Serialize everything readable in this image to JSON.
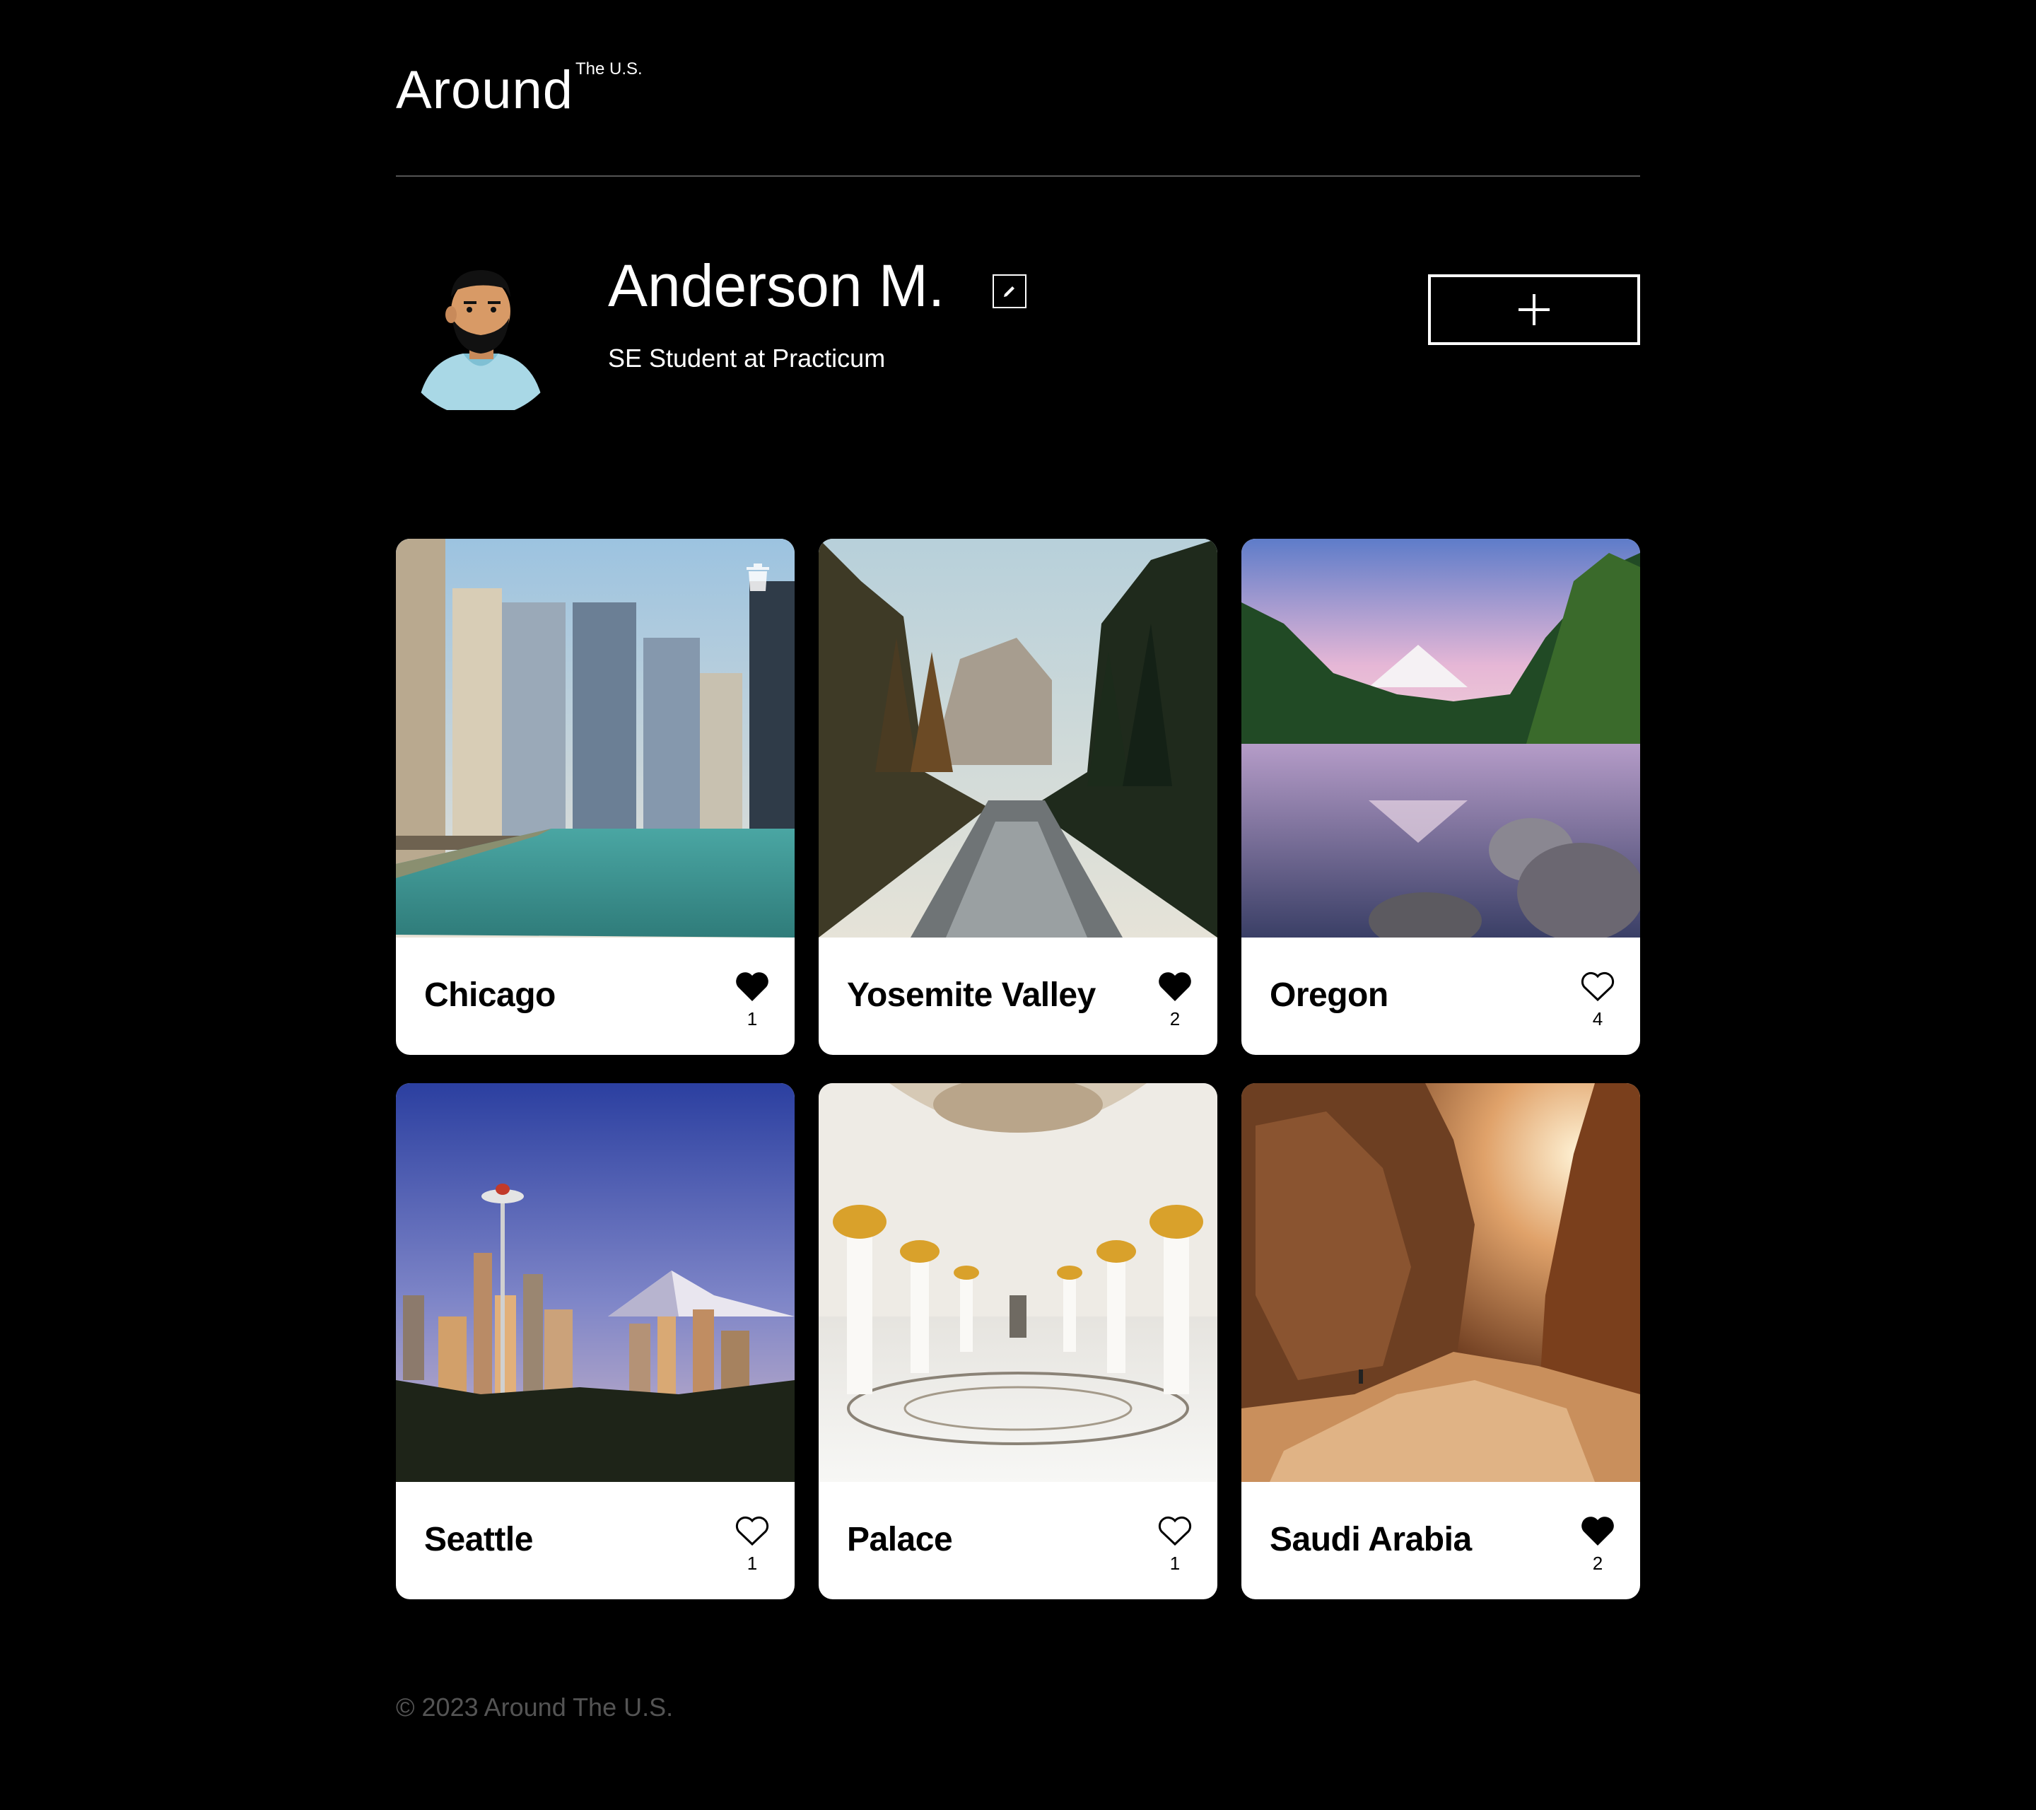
{
  "header": {
    "logo_main": "Around",
    "logo_sup": "The U.S."
  },
  "profile": {
    "name": "Anderson M.",
    "about": "SE Student at Practicum",
    "edit_icon": "pencil-icon",
    "add_icon": "plus-icon"
  },
  "cards": [
    {
      "title": "Chicago",
      "likes": "1",
      "liked": true,
      "has_delete": true,
      "scene": "city-river"
    },
    {
      "title": "Yosemite Valley",
      "likes": "2",
      "liked": true,
      "has_delete": false,
      "scene": "forest-river"
    },
    {
      "title": "Oregon",
      "likes": "4",
      "liked": false,
      "has_delete": false,
      "scene": "mountain-lake"
    },
    {
      "title": "Seattle",
      "likes": "1",
      "liked": false,
      "has_delete": false,
      "scene": "city-skyline"
    },
    {
      "title": "Palace",
      "likes": "1",
      "liked": false,
      "has_delete": false,
      "scene": "palace-hall"
    },
    {
      "title": "Saudi Arabia",
      "likes": "2",
      "liked": true,
      "has_delete": false,
      "scene": "desert-canyon"
    }
  ],
  "footer": {
    "copyright": "© 2023 Around The U.S."
  },
  "colors": {
    "background": "#000000",
    "card": "#ffffff",
    "divider": "#545454",
    "footer_text": "#545454"
  }
}
